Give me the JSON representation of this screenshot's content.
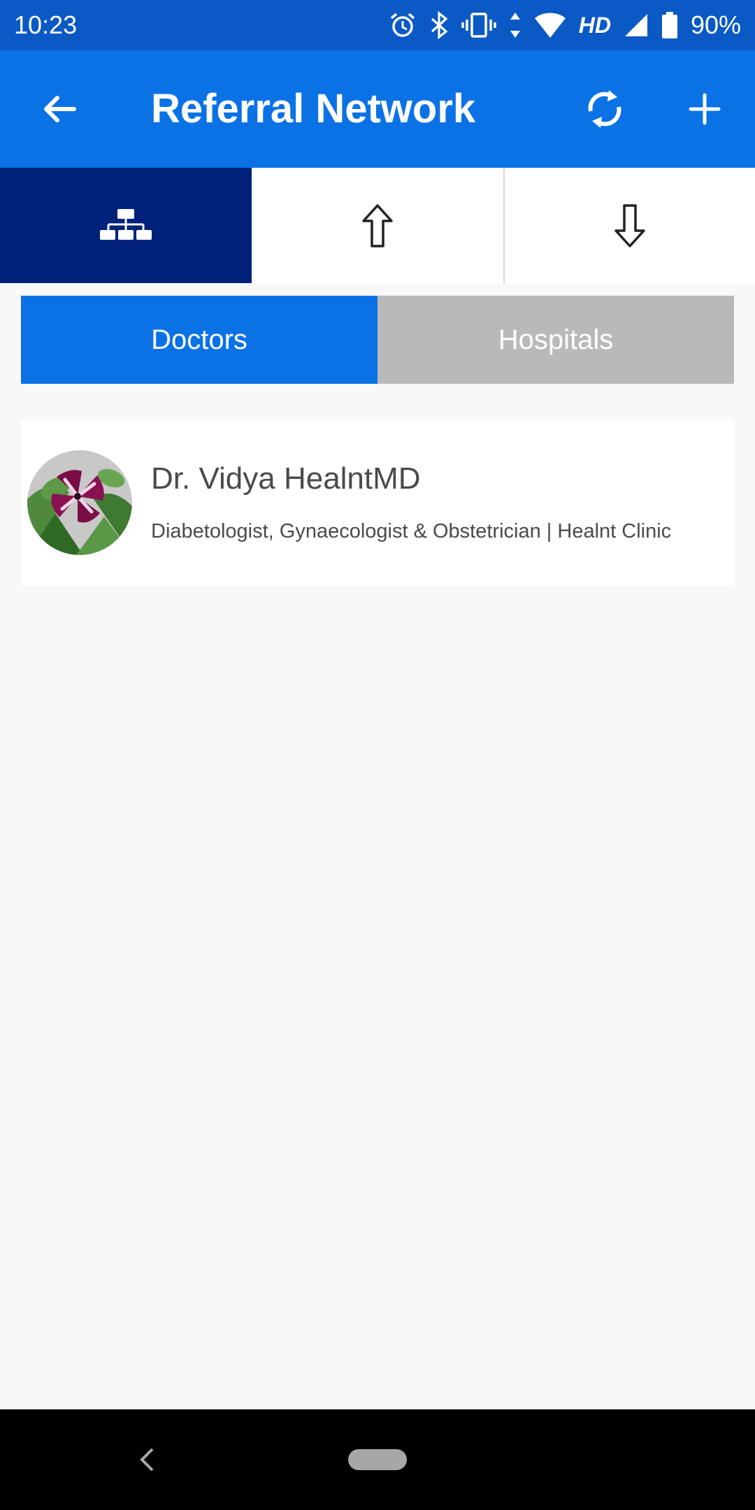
{
  "status_bar": {
    "time": "10:23",
    "icons": [
      "alarm-icon",
      "bluetooth-icon",
      "vibrate-icon",
      "data-arrows-icon",
      "wifi-icon"
    ],
    "network_label": "HD",
    "battery_percent": "90%"
  },
  "app_bar": {
    "title": "Referral Network",
    "back_icon": "arrow-left-icon",
    "refresh_icon": "refresh-icon",
    "add_icon": "plus-icon",
    "color": "#0b72e6"
  },
  "icon_tabs": [
    {
      "icon": "network-hierarchy-icon",
      "selected": true
    },
    {
      "icon": "arrow-up-icon",
      "selected": false
    },
    {
      "icon": "arrow-down-icon",
      "selected": false
    }
  ],
  "segment": {
    "doctors_label": "Doctors",
    "hospitals_label": "Hospitals",
    "selected": "Doctors"
  },
  "doctors": [
    {
      "name": "Dr. Vidya HealntMD",
      "subtitle": "Diabetologist, Gynaecologist & Obstetrician |  Healnt Clinic",
      "avatar": "flower-photo"
    }
  ],
  "colors": {
    "primary": "#0b72e6",
    "selected_tab": "#00217a",
    "inactive_segment": "#b9b9b9"
  }
}
